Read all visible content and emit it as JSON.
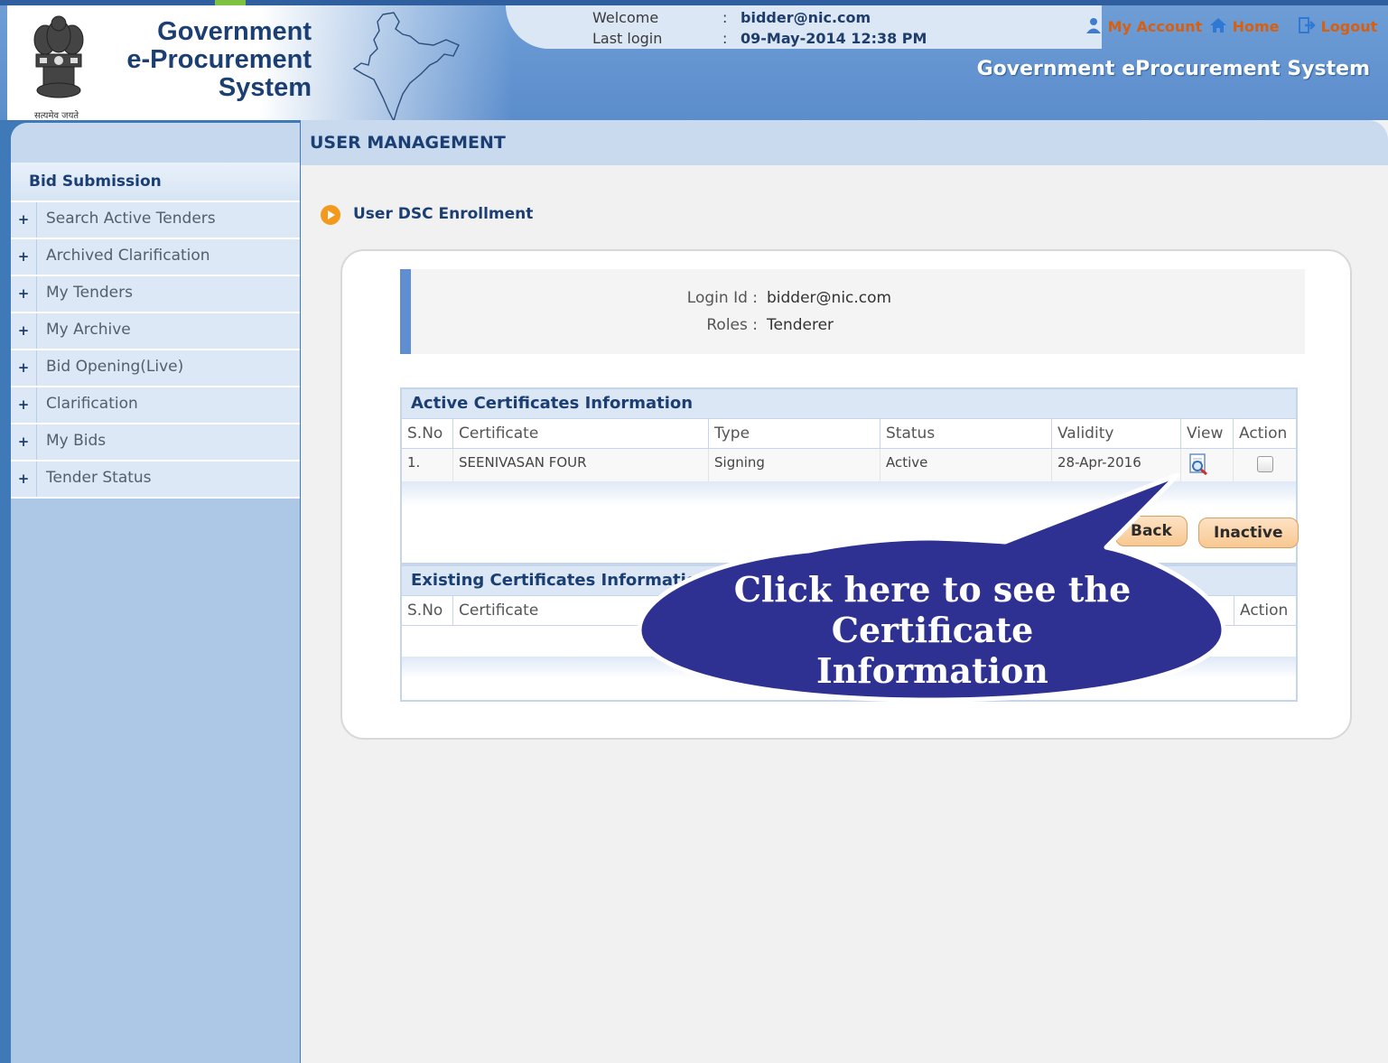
{
  "header": {
    "logo_line1": "Government",
    "logo_line2": "e-Procurement",
    "logo_line3": "System",
    "motto": "सत्यमेव जयते",
    "welcome_label": "Welcome",
    "welcome_value": "bidder@nic.com",
    "last_login_label": "Last login",
    "last_login_value": "09-May-2014 12:38 PM",
    "separator": ":",
    "links": {
      "my_account": "My Account",
      "home": "Home",
      "logout": "Logout"
    },
    "system_title": "Government eProcurement System"
  },
  "sidebar": {
    "title": "Bid Submission",
    "items": [
      {
        "label": "Search Active Tenders"
      },
      {
        "label": "Archived Clarification"
      },
      {
        "label": "My Tenders"
      },
      {
        "label": "My Archive"
      },
      {
        "label": "Bid Opening(Live)"
      },
      {
        "label": "Clarification"
      },
      {
        "label": "My Bids"
      },
      {
        "label": "Tender Status"
      }
    ]
  },
  "main": {
    "section_title": "USER MANAGEMENT",
    "page_heading": "User DSC Enrollment",
    "login_id_label": "Login Id :",
    "login_id_value": "bidder@nic.com",
    "roles_label": "Roles :",
    "roles_value": "Tenderer",
    "active_table": {
      "caption": "Active Certificates Information",
      "columns": [
        "S.No",
        "Certificate",
        "Type",
        "Status",
        "Validity",
        "View",
        "Action"
      ],
      "rows": [
        {
          "sno": "1.",
          "certificate": "SEENIVASAN FOUR",
          "type": "Signing",
          "status": "Active",
          "validity": "28-Apr-2016"
        }
      ]
    },
    "buttons": {
      "back": "Back",
      "inactive": "Inactive"
    },
    "existing_table": {
      "caption": "Existing Certificates Information",
      "columns": [
        "S.No",
        "Certificate",
        "Action"
      ]
    }
  },
  "callout": {
    "text": "Click here to see the Certificate Information",
    "line1": "Click here to see the",
    "line2": "Certificate",
    "line3": "Information",
    "fill": "#2e3192"
  },
  "colors": {
    "header_blue": "#5b8dcc",
    "dark_blue_text": "#1c3f73",
    "orange_link": "#d85f0f",
    "sidebar_bg": "#adc8e6"
  }
}
